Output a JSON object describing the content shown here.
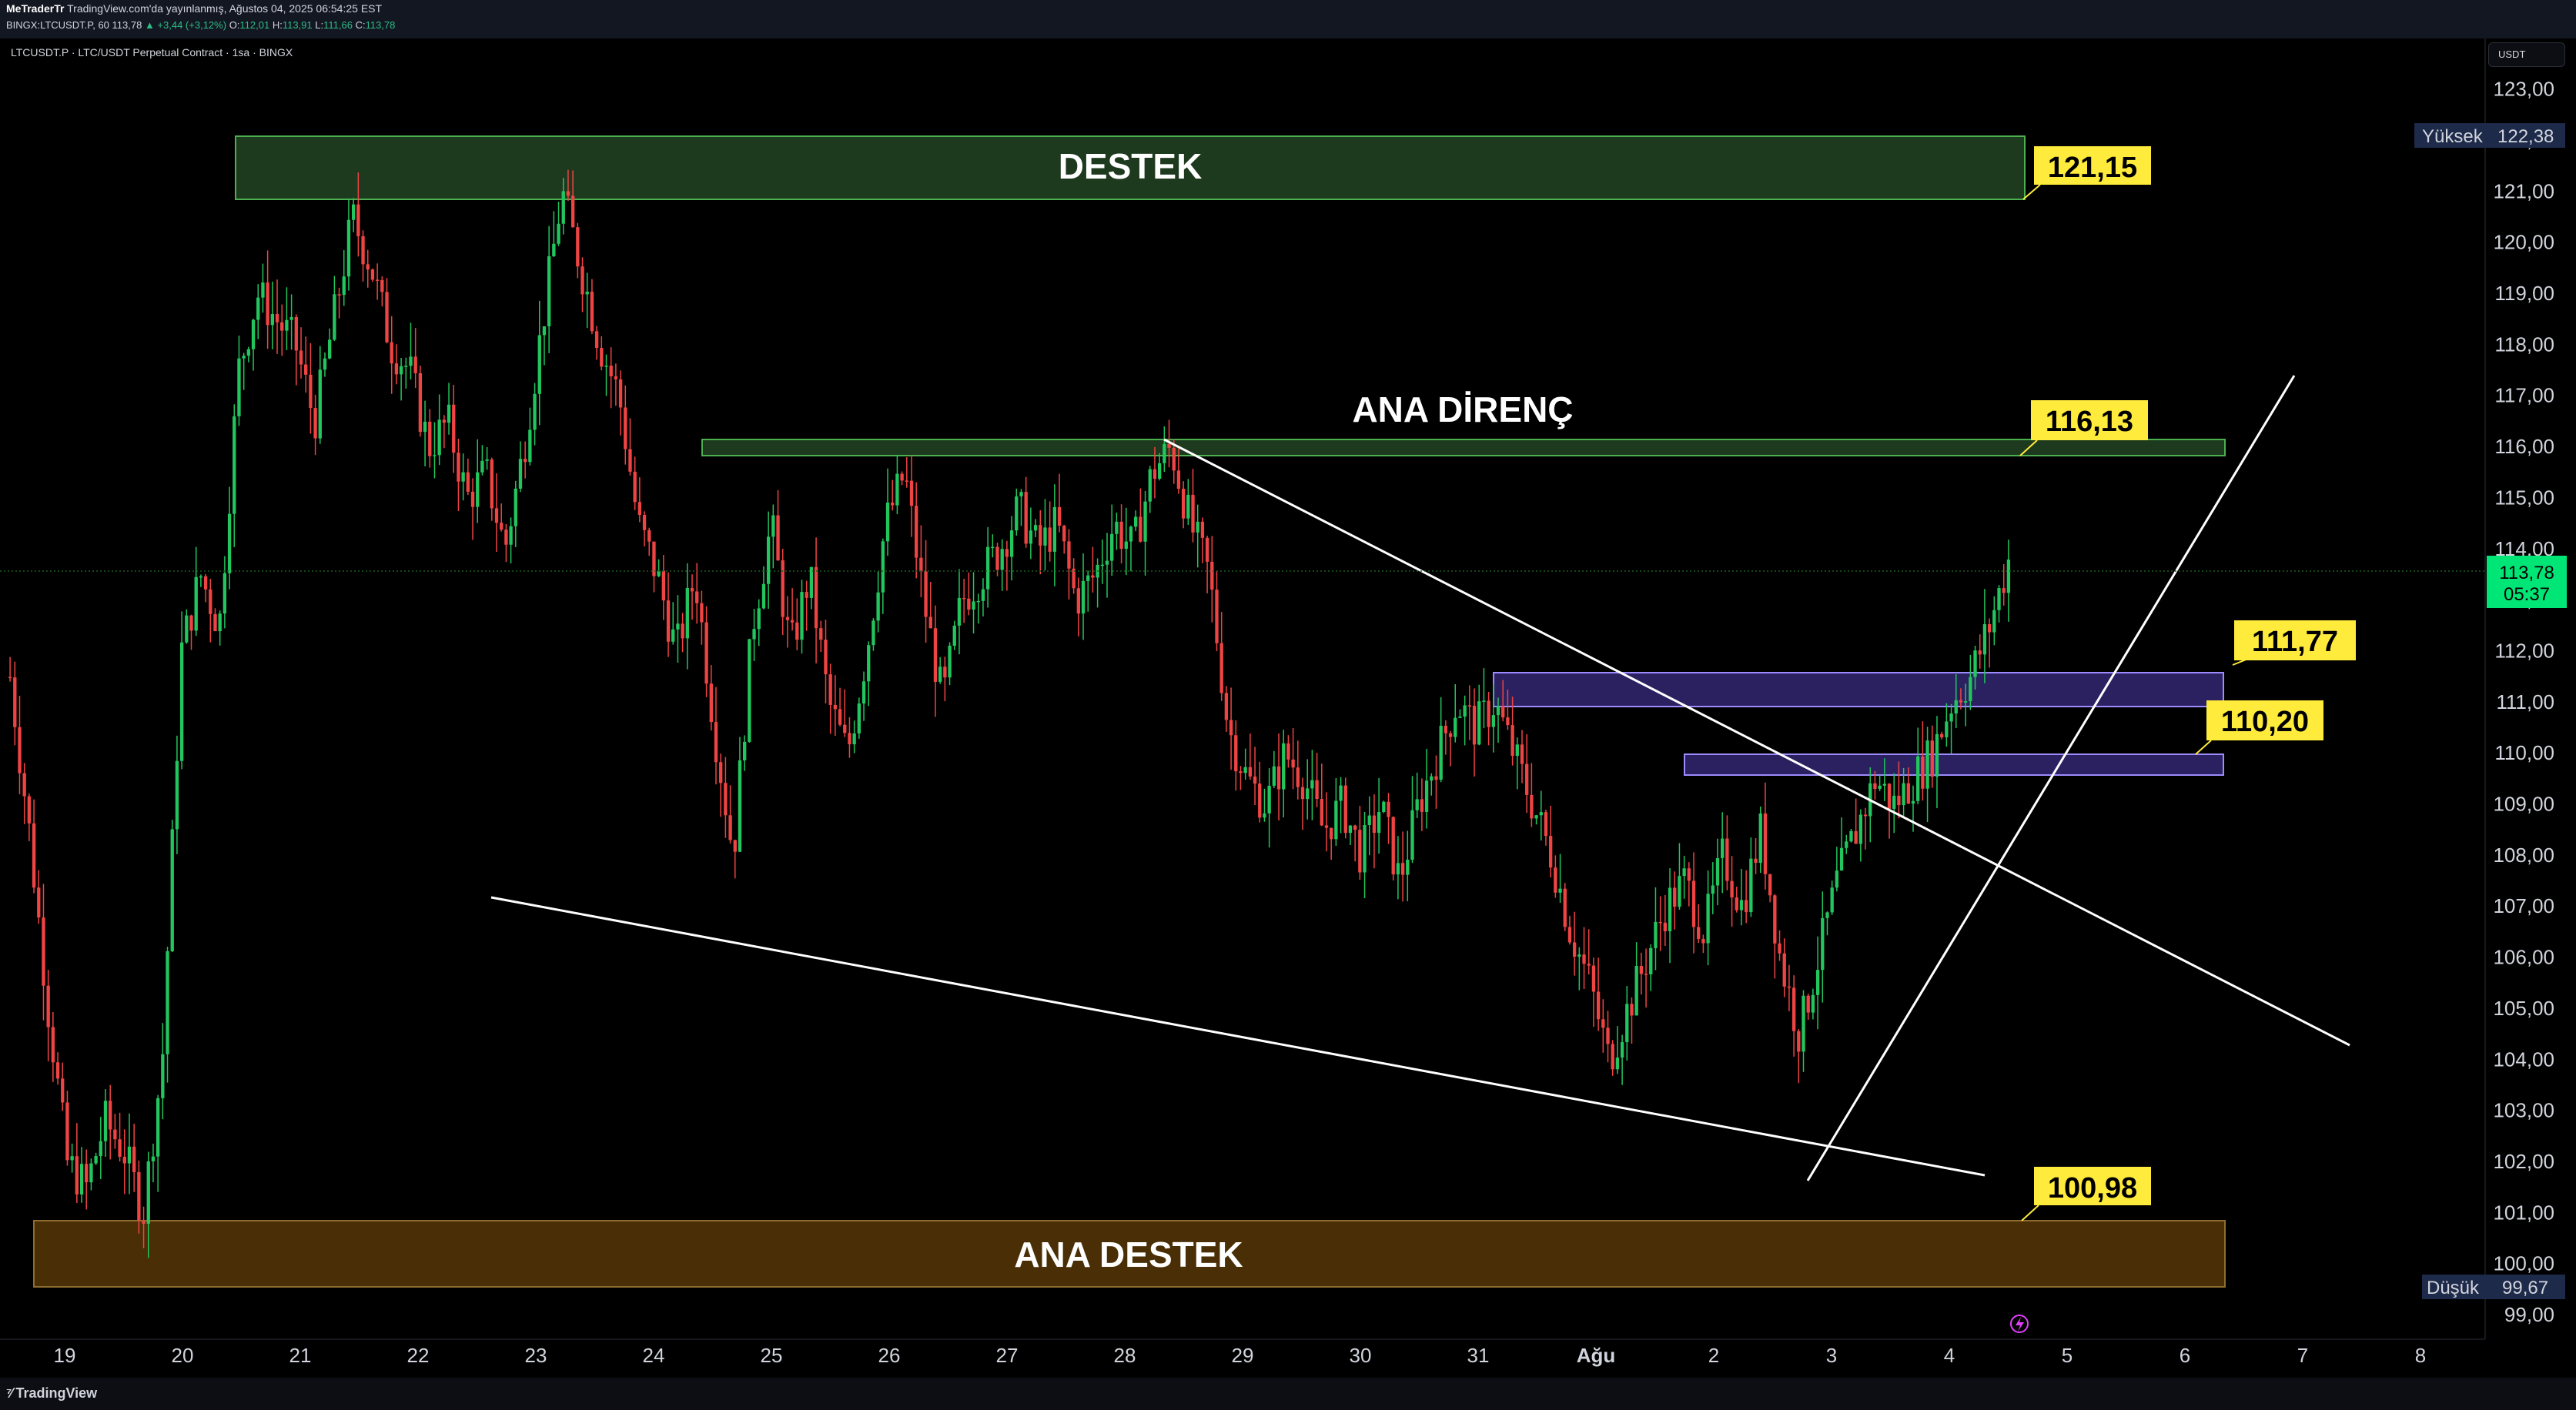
{
  "header": {
    "author": "MeTraderTr",
    "published": "TradingView.com'da yayınlanmış, Ağustos 04, 2025 06:54:25 EST",
    "ohlc_symbol": "BINGX:LTCUSDT.P, 60",
    "last": "113,78",
    "change": "▲ +3,44 (+3,12%)",
    "o_label": "O:",
    "o": "112,01",
    "h_label": "H:",
    "h": "113,91",
    "l_label": "L:",
    "l": "111,66",
    "c_label": "C:",
    "c": "113,78"
  },
  "symbol_line": "LTCUSDT.P · LTC/USDT Perpetual Contract · 1sa · BINGX",
  "currency_button": "USDT",
  "price_axis": {
    "ticks": [
      "123,00",
      "122,00",
      "121,00",
      "120,00",
      "119,00",
      "118,00",
      "117,00",
      "116,00",
      "115,00",
      "114,00",
      "113,00",
      "112,00",
      "111,00",
      "110,00",
      "109,00",
      "108,00",
      "107,00",
      "106,00",
      "105,00",
      "104,00",
      "103,00",
      "102,00",
      "101,00",
      "100,00",
      "99,00"
    ],
    "high_label": "Yüksek",
    "high_value": "122,38",
    "low_label": "Düşük",
    "low_value": "99,67",
    "current_price": "113,78",
    "countdown": "05:37"
  },
  "time_axis": {
    "labels": [
      "19",
      "20",
      "21",
      "22",
      "23",
      "24",
      "25",
      "26",
      "27",
      "28",
      "29",
      "30",
      "31",
      "Ağu",
      "2",
      "3",
      "4",
      "5",
      "6",
      "7",
      "8"
    ]
  },
  "zones": {
    "destek_label": "DESTEK",
    "ana_direnc_label": "ANA DİRENÇ",
    "ana_destek_label": "ANA DESTEK"
  },
  "callouts": {
    "c1": "121,15",
    "c2": "116,13",
    "c3": "111,77",
    "c4": "110,20",
    "c5": "100,98"
  },
  "colors": {
    "bull": "#22c55e",
    "bear": "#ef4444",
    "callout_bg": "#ffeb3b",
    "destek_fill": "#1e3a1e",
    "destek_border": "#4caf50",
    "ana_destek_fill": "#4a2e05",
    "zone_purple": "#2b2160",
    "zone_purple_border": "#9c8cff",
    "price_green": "#00e676",
    "hilo_bg": "#1e2a4a"
  },
  "footer": {
    "brand": "TradingView"
  },
  "chart_data": {
    "type": "candlestick",
    "symbol": "LTCUSDT.P",
    "interval": "1sa",
    "x_range": [
      "19",
      "8"
    ],
    "ylim": [
      99,
      123
    ],
    "path_points": [
      [
        "19",
        111.5
      ],
      [
        "19",
        108.5
      ],
      [
        "19",
        105.0
      ],
      [
        "19",
        102.0
      ],
      [
        "19",
        101.5
      ],
      [
        "19",
        102.8
      ],
      [
        "19",
        102.2
      ],
      [
        "20",
        101.0
      ],
      [
        "20",
        104.0
      ],
      [
        "20",
        112.0
      ],
      [
        "20",
        113.5
      ],
      [
        "20",
        112.5
      ],
      [
        "20",
        117.5
      ],
      [
        "20",
        119.0
      ],
      [
        "20",
        118.5
      ],
      [
        "21",
        118.0
      ],
      [
        "21",
        116.5
      ],
      [
        "21",
        118.5
      ],
      [
        "21",
        120.5
      ],
      [
        "21",
        119.5
      ],
      [
        "21",
        118.0
      ],
      [
        "22",
        117.5
      ],
      [
        "22",
        116.0
      ],
      [
        "22",
        116.5
      ],
      [
        "22",
        115.0
      ],
      [
        "22",
        115.5
      ],
      [
        "22",
        114.0
      ],
      [
        "23",
        116.0
      ],
      [
        "23",
        118.5
      ],
      [
        "23",
        121.0
      ],
      [
        "23",
        119.5
      ],
      [
        "23",
        118.0
      ],
      [
        "23",
        117.0
      ],
      [
        "24",
        114.5
      ],
      [
        "24",
        113.5
      ],
      [
        "24",
        112.0
      ],
      [
        "24",
        113.5
      ],
      [
        "24",
        110.5
      ],
      [
        "24",
        108.0
      ],
      [
        "25",
        112.5
      ],
      [
        "25",
        114.5
      ],
      [
        "25",
        112.0
      ],
      [
        "25",
        113.5
      ],
      [
        "25",
        111.0
      ],
      [
        "25",
        110.0
      ],
      [
        "26",
        112.0
      ],
      [
        "26",
        114.5
      ],
      [
        "26",
        115.5
      ],
      [
        "26",
        113.0
      ],
      [
        "26",
        111.0
      ],
      [
        "26",
        113.0
      ],
      [
        "27",
        113.5
      ],
      [
        "27",
        114.0
      ],
      [
        "27",
        114.8
      ],
      [
        "27",
        114.0
      ],
      [
        "27",
        114.5
      ],
      [
        "27",
        113.0
      ],
      [
        "28",
        113.5
      ],
      [
        "28",
        114.5
      ],
      [
        "28",
        114.0
      ],
      [
        "28",
        115.5
      ],
      [
        "28",
        116.0
      ],
      [
        "28",
        114.5
      ],
      [
        "29",
        113.5
      ],
      [
        "29",
        110.5
      ],
      [
        "29",
        109.5
      ],
      [
        "29",
        109.0
      ],
      [
        "29",
        110.0
      ],
      [
        "29",
        109.5
      ],
      [
        "30",
        108.5
      ],
      [
        "30",
        109.0
      ],
      [
        "30",
        108.0
      ],
      [
        "30",
        109.0
      ],
      [
        "30",
        107.5
      ],
      [
        "30",
        109.0
      ],
      [
        "31",
        110.0
      ],
      [
        "31",
        111.0
      ],
      [
        "31",
        110.5
      ],
      [
        "31",
        111.0
      ],
      [
        "31",
        110.0
      ],
      [
        "Ağu",
        109.0
      ],
      [
        "Ağu",
        108.0
      ],
      [
        "Ağu",
        106.5
      ],
      [
        "Ağu",
        105.5
      ],
      [
        "Ağu",
        104.0
      ],
      [
        "Ağu",
        105.0
      ],
      [
        "Ağu",
        106.0
      ],
      [
        "2",
        107.0
      ],
      [
        "2",
        107.5
      ],
      [
        "2",
        106.5
      ],
      [
        "2",
        108.0
      ],
      [
        "2",
        107.0
      ],
      [
        "2",
        108.5
      ],
      [
        "3",
        106.0
      ],
      [
        "3",
        104.5
      ],
      [
        "3",
        106.0
      ],
      [
        "3",
        107.5
      ],
      [
        "3",
        108.5
      ],
      [
        "3",
        109.5
      ],
      [
        "4",
        109.0
      ],
      [
        "4",
        109.5
      ],
      [
        "4",
        110.0
      ],
      [
        "4",
        111.0
      ],
      [
        "4",
        111.5
      ],
      [
        "4",
        112.5
      ],
      [
        "4",
        113.78
      ]
    ],
    "annotations": [
      {
        "text": "DESTEK",
        "price_low": 121.15,
        "price_high": 122.4
      },
      {
        "text": "ANA DİRENÇ",
        "price_low": 116.0,
        "price_high": 116.3
      },
      {
        "text": "ANA DESTEK",
        "price_low": 99.7,
        "price_high": 100.98
      }
    ],
    "levels": [
      121.15,
      116.13,
      111.77,
      110.2,
      100.98
    ]
  }
}
